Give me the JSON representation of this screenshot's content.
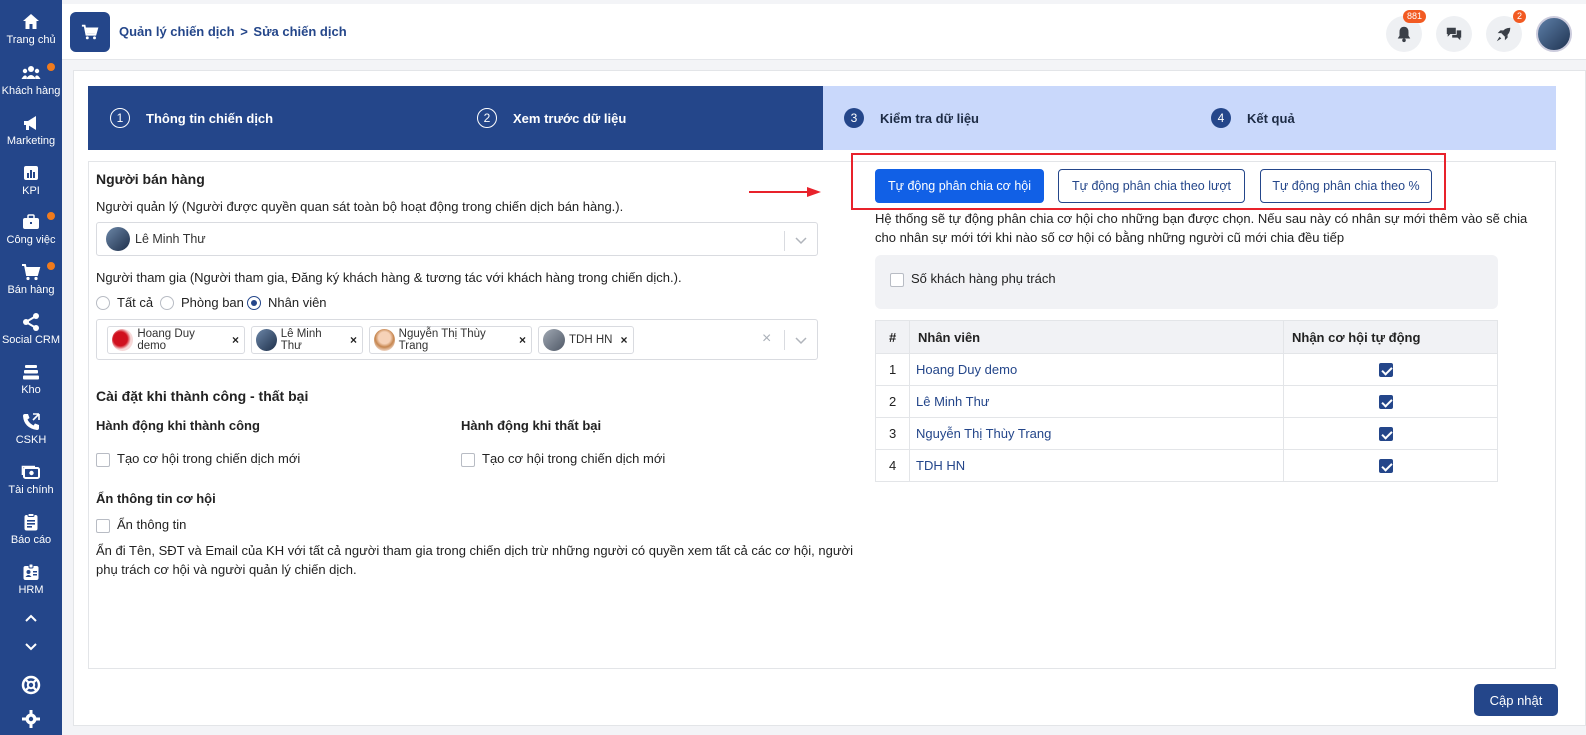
{
  "sidebar": {
    "items": [
      {
        "label": "Trang chủ",
        "icon": "home-icon",
        "dot": false
      },
      {
        "label": "Khách hàng",
        "icon": "users-icon",
        "dot": true
      },
      {
        "label": "Marketing",
        "icon": "megaphone-icon",
        "dot": false
      },
      {
        "label": "KPI",
        "icon": "chart-icon",
        "dot": false
      },
      {
        "label": "Công việc",
        "icon": "briefcase-icon",
        "dot": true
      },
      {
        "label": "Bán hàng",
        "icon": "cart-icon",
        "dot": true
      },
      {
        "label": "Social CRM",
        "icon": "share-icon",
        "dot": false
      },
      {
        "label": "Kho",
        "icon": "warehouse-icon",
        "dot": false
      },
      {
        "label": "CSKH",
        "icon": "phone-icon",
        "dot": false
      },
      {
        "label": "Tài chính",
        "icon": "money-icon",
        "dot": false
      },
      {
        "label": "Báo cáo",
        "icon": "clipboard-icon",
        "dot": false
      },
      {
        "label": "HRM",
        "icon": "id-badge-icon",
        "dot": false
      }
    ],
    "accent_dot_color": "#f07b1d",
    "bg_color": "#24468a"
  },
  "header": {
    "breadcrumb": [
      "Quản lý chiến dịch",
      ">",
      "Sửa chiến dịch"
    ],
    "notifications_count": "881",
    "rocket_count": "2"
  },
  "steps": [
    {
      "num": "1",
      "label": "Thông tin chiến dịch"
    },
    {
      "num": "2",
      "label": "Xem trước dữ liệu"
    },
    {
      "num": "3",
      "label": "Kiểm tra dữ liệu"
    },
    {
      "num": "4",
      "label": "Kết quả"
    }
  ],
  "left": {
    "section_title": "Người bán hàng",
    "manager_label": "Người quản lý (Người được quyền quan sát toàn bộ hoạt động trong chiến dịch bán hàng.).",
    "manager_value": "Lê Minh Thư",
    "participant_label": "Người tham gia (Người tham gia, Đăng ký khách hàng & tương tác với khách hàng trong chiến dịch.).",
    "radio_options": [
      "Tất cả",
      "Phòng ban",
      "Nhân viên"
    ],
    "radio_selected": "Nhân viên",
    "chips": [
      "Hoang Duy demo",
      "Lê Minh Thư",
      "Nguyễn Thị Thùy Trang",
      "TDH HN"
    ],
    "result_title": "Cài đặt khi thành công - thất bại",
    "success_title": "Hành động khi thành công",
    "fail_title": "Hành động khi thất bại",
    "success_option": "Tạo cơ hội trong chiến dịch mới",
    "fail_option": "Tạo cơ hội trong chiến dịch mới",
    "hide_title": "Ẩn thông tin cơ hội",
    "hide_option": "Ẩn thông tin",
    "hide_desc_1": "Ẩn đi Tên, SĐT và Email của KH với tất cả người tham gia trong chiến dịch trừ những người có quyền xem tất cả các cơ hội, người",
    "hide_desc_2": "phụ trách cơ hội và người quản lý chiến dịch."
  },
  "right": {
    "tabs": [
      "Tự động phân chia cơ hội",
      "Tự động phân chia theo lượt",
      "Tự động phân chia theo %"
    ],
    "active_tab": "Tự động phân chia cơ hội",
    "desc_1": "Hệ thống sẽ tự động phân chia cơ hội cho những bạn được chọn. Nếu sau này có nhân sự mới thêm vào sẽ chia",
    "desc_2": "cho nhân sự mới tới khi nào số cơ hội có bằng những người cũ mới chia đều tiếp",
    "option_label": "Số khách hàng phụ trách",
    "table": {
      "headers": [
        "#",
        "Nhân viên",
        "Nhận cơ hội tự động"
      ],
      "rows": [
        {
          "idx": "1",
          "name": "Hoang Duy demo",
          "checked": true
        },
        {
          "idx": "2",
          "name": "Lê Minh Thư",
          "checked": true
        },
        {
          "idx": "3",
          "name": "Nguyễn Thị Thùy Trang",
          "checked": true
        },
        {
          "idx": "4",
          "name": "TDH HN",
          "checked": true
        }
      ]
    }
  },
  "footer": {
    "save_label": "Cập nhật"
  },
  "colors": {
    "primary": "#24468a",
    "active_tab": "#1160e6",
    "highlight_box": "#e8222b",
    "badge": "#f25a22"
  }
}
